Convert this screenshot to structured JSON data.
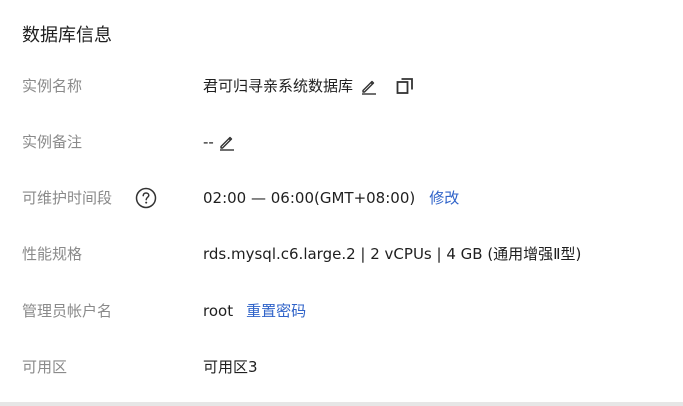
{
  "section": {
    "title": "数据库信息"
  },
  "rows": {
    "instance_name": {
      "label": "实例名称",
      "value": "君可归寻亲系统数据库"
    },
    "instance_note": {
      "label": "实例备注",
      "value": "--"
    },
    "maintenance_window": {
      "label": "可维护时间段",
      "value": "02:00 — 06:00(GMT+08:00)",
      "action": "修改"
    },
    "spec": {
      "label": "性能规格",
      "value": "rds.mysql.c6.large.2 | 2 vCPUs | 4 GB (通用增强Ⅱ型)"
    },
    "admin_account": {
      "label": "管理员帐户名",
      "value": "root",
      "action": "重置密码"
    },
    "zone": {
      "label": "可用区",
      "value": "可用区3"
    }
  },
  "icons": {
    "edit": "pencil-icon",
    "copy": "copy-icon",
    "help": "question-circle-icon"
  },
  "colors": {
    "label": "#8a8a8a",
    "value": "#1f1f1f",
    "link": "#2f63c9"
  }
}
